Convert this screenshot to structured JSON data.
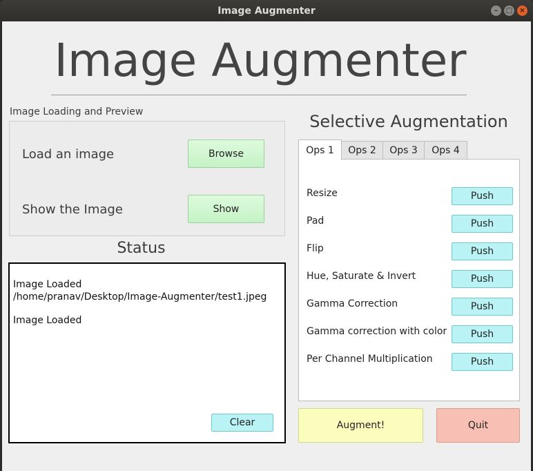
{
  "window": {
    "title": "Image Augmenter"
  },
  "header": {
    "title": "Image Augmenter"
  },
  "loading": {
    "group_title": "Image Loading and Preview",
    "load_label": "Load an image",
    "browse_label": "Browse",
    "show_label": "Show the Image",
    "show_button": "Show"
  },
  "status": {
    "title": "Status",
    "lines": [
      "Image Loaded",
      "/home/pranav/Desktop/Image-Augmenter/test1.jpeg",
      "",
      "Image Loaded"
    ],
    "clear_label": "Clear"
  },
  "augmentation": {
    "title": "Selective Augmentation",
    "tabs": [
      "Ops 1",
      "Ops 2",
      "Ops 3",
      "Ops 4"
    ],
    "active_tab": "Ops 1",
    "ops": [
      {
        "label": "Resize",
        "button": "Push"
      },
      {
        "label": "Pad",
        "button": "Push"
      },
      {
        "label": "Flip",
        "button": "Push"
      },
      {
        "label": "Hue, Saturate & Invert",
        "button": "Push"
      },
      {
        "label": "Gamma Correction",
        "button": "Push"
      },
      {
        "label": "Gamma correction with color",
        "button": "Push"
      },
      {
        "label": "Per Channel Multiplication",
        "button": "Push"
      }
    ]
  },
  "actions": {
    "augment_label": "Augment!",
    "quit_label": "Quit"
  },
  "colors": {
    "green_button": "#c6f2c6",
    "cyan_button": "#b9f3f6",
    "augment_button": "#fbfdbd",
    "quit_button": "#f8c0b4"
  }
}
